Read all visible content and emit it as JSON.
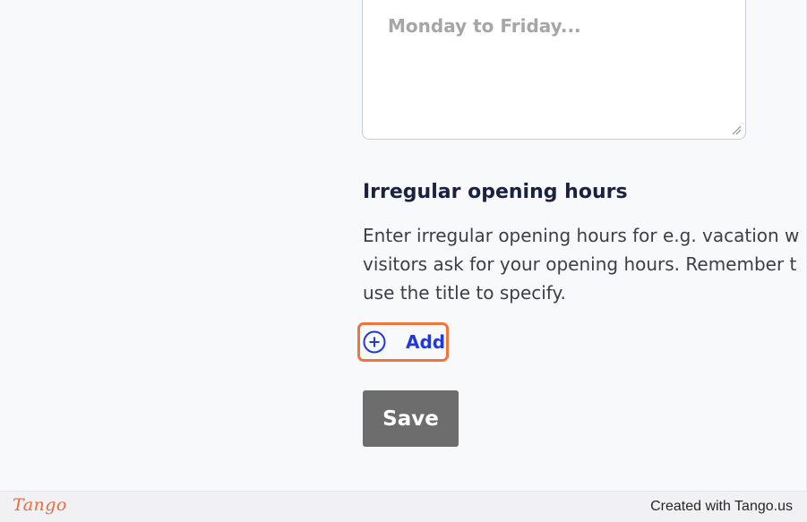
{
  "hours_form": {
    "textarea_placeholder": "Monday to Friday..."
  },
  "irregular_hours": {
    "title": "Irregular opening hours",
    "description_lines": [
      "Enter irregular opening hours for e.g. vacation w",
      "visitors ask for your opening hours. Remember t",
      "use the title to specify."
    ],
    "add_label": "Add"
  },
  "actions": {
    "save_label": "Save"
  },
  "footer": {
    "logo_text": "Tango",
    "credit": "Created with Tango.us"
  },
  "colors": {
    "accent_highlight": "#f0753d",
    "link_blue": "#2338d8",
    "save_button": "#6d6d6d",
    "title_navy": "#1b2140",
    "tango_orange": "#ef6a3a"
  },
  "icons": {
    "add": "plus-circle-icon",
    "resize": "resize-grip-icon"
  }
}
